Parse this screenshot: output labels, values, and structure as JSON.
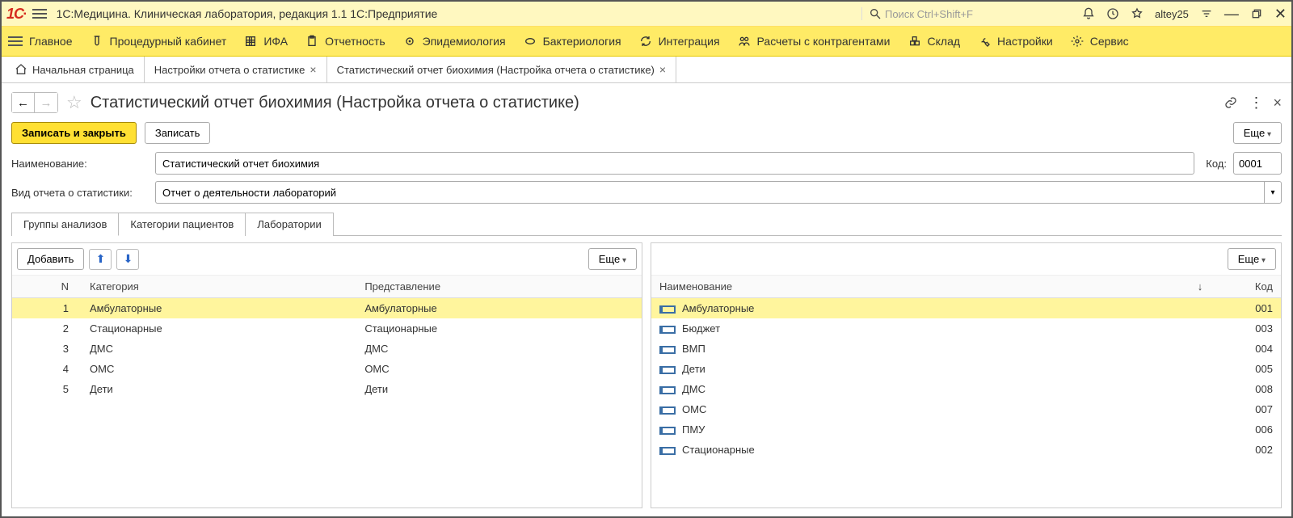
{
  "app": {
    "title": "1С:Медицина. Клиническая лаборатория, редакция 1.1 1С:Предприятие",
    "search_placeholder": "Поиск Ctrl+Shift+F",
    "username": "altey25"
  },
  "nav": {
    "main": "Главное",
    "procedure": "Процедурный кабинет",
    "ifa": "ИФА",
    "reports": "Отчетность",
    "epidem": "Эпидемиология",
    "bacteriology": "Бактериология",
    "integration": "Интеграция",
    "contr": "Расчеты с контрагентами",
    "warehouse": "Склад",
    "settings": "Настройки",
    "service": "Сервис"
  },
  "tabs": {
    "home": "Начальная страница",
    "t1": "Настройки отчета о статистике",
    "t2": "Статистический отчет биохимия (Настройка отчета о статистике)"
  },
  "page": {
    "title": "Статистический отчет биохимия (Настройка отчета о статистике)",
    "write_close": "Записать и закрыть",
    "write": "Записать",
    "more": "Еще"
  },
  "form": {
    "name_label": "Наименование:",
    "name_value": "Статистический отчет биохимия",
    "code_label": "Код:",
    "code_value": "0001",
    "type_label": "Вид отчета о статистики:",
    "type_value": "Отчет о деятельности лабораторий"
  },
  "subtabs": {
    "groups": "Группы анализов",
    "categories": "Категории пациентов",
    "labs": "Лаборатории"
  },
  "left": {
    "add": "Добавить",
    "more": "Еще",
    "cols": {
      "n": "N",
      "cat": "Категория",
      "repr": "Представление"
    },
    "rows": [
      {
        "n": 1,
        "cat": "Амбулаторные",
        "repr": "Амбулаторные",
        "selected": true
      },
      {
        "n": 2,
        "cat": "Стационарные",
        "repr": "Стационарные"
      },
      {
        "n": 3,
        "cat": "ДМС",
        "repr": "ДМС"
      },
      {
        "n": 4,
        "cat": "ОМС",
        "repr": "ОМС"
      },
      {
        "n": 5,
        "cat": "Дети",
        "repr": "Дети"
      }
    ]
  },
  "right": {
    "more": "Еще",
    "cols": {
      "name": "Наименование",
      "sort": "↓",
      "code": "Код"
    },
    "rows": [
      {
        "name": "Амбулаторные",
        "code": "001",
        "selected": true
      },
      {
        "name": "Бюджет",
        "code": "003"
      },
      {
        "name": "ВМП",
        "code": "004"
      },
      {
        "name": "Дети",
        "code": "005"
      },
      {
        "name": "ДМС",
        "code": "008"
      },
      {
        "name": "ОМС",
        "code": "007"
      },
      {
        "name": "ПМУ",
        "code": "006"
      },
      {
        "name": "Стационарные",
        "code": "002"
      }
    ]
  }
}
